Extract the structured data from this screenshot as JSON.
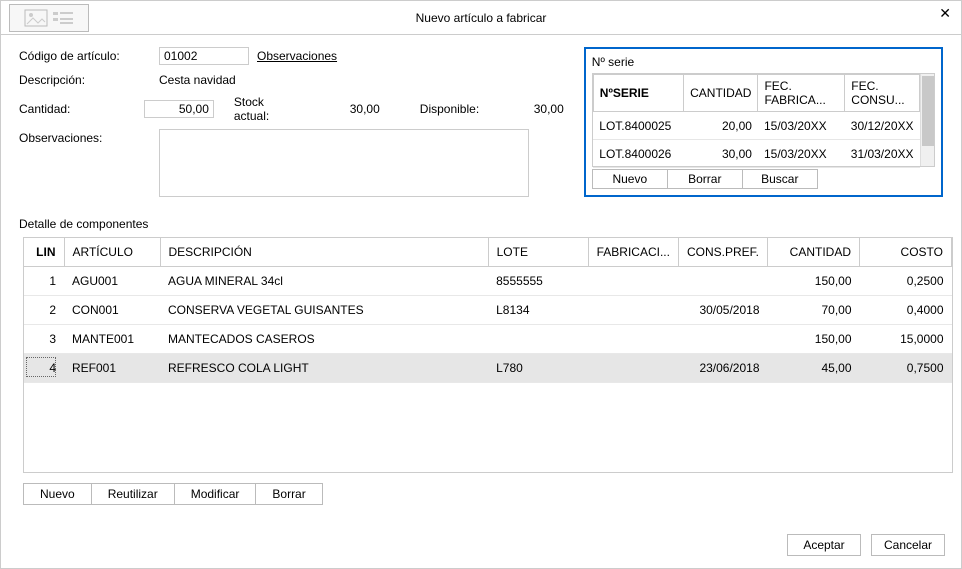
{
  "window": {
    "title": "Nuevo artículo a fabricar"
  },
  "form": {
    "codigo_label": "Código de artículo:",
    "codigo_value": "01002",
    "observaciones_link": "Observaciones",
    "descripcion_label": "Descripción:",
    "descripcion_value": "Cesta navidad",
    "cantidad_label": "Cantidad:",
    "cantidad_value": "50,00",
    "stock_label": "Stock actual:",
    "stock_value": "30,00",
    "disponible_label": "Disponible:",
    "disponible_value": "30,00",
    "obs2_label": "Observaciones:"
  },
  "serie": {
    "heading": "Nº serie",
    "cols": {
      "c0": "NºSERIE",
      "c1": "CANTIDAD",
      "c2": "FEC. FABRICA...",
      "c3": "FEC. CONSU..."
    },
    "rows": [
      {
        "serie": "LOT.8400025",
        "cant": "20,00",
        "fab": "15/03/20XX",
        "cons": "30/12/20XX"
      },
      {
        "serie": "LOT.8400026",
        "cant": "30,00",
        "fab": "15/03/20XX",
        "cons": "31/03/20XX"
      }
    ],
    "btns": {
      "nuevo": "Nuevo",
      "borrar": "Borrar",
      "buscar": "Buscar"
    }
  },
  "components": {
    "section_label": "Detalle de componentes",
    "cols": {
      "lin": "LIN",
      "art": "ARTÍCULO",
      "desc": "DESCRIPCIÓN",
      "lote": "LOTE",
      "fab": "FABRICACI...",
      "cons": "CONS.PREF.",
      "cant": "CANTIDAD",
      "costo": "COSTO"
    },
    "rows": [
      {
        "lin": "1",
        "art": "AGU001",
        "desc": "AGUA MINERAL 34cl",
        "lote": "8555555",
        "fab": "",
        "cons": "",
        "cant": "150,00",
        "costo": "0,2500"
      },
      {
        "lin": "2",
        "art": "CON001",
        "desc": "CONSERVA VEGETAL GUISANTES",
        "lote": "L8134",
        "fab": "",
        "cons": "30/05/2018",
        "cant": "70,00",
        "costo": "0,4000"
      },
      {
        "lin": "3",
        "art": "MANTE001",
        "desc": "MANTECADOS CASEROS",
        "lote": "",
        "fab": "",
        "cons": "",
        "cant": "150,00",
        "costo": "15,0000"
      },
      {
        "lin": "4",
        "art": "REF001",
        "desc": "REFRESCO COLA LIGHT",
        "lote": "L780",
        "fab": "",
        "cons": "23/06/2018",
        "cant": "45,00",
        "costo": "0,7500"
      }
    ],
    "btns": {
      "nuevo": "Nuevo",
      "reutilizar": "Reutilizar",
      "modificar": "Modificar",
      "borrar": "Borrar"
    }
  },
  "dialog": {
    "aceptar": "Aceptar",
    "cancelar": "Cancelar"
  }
}
